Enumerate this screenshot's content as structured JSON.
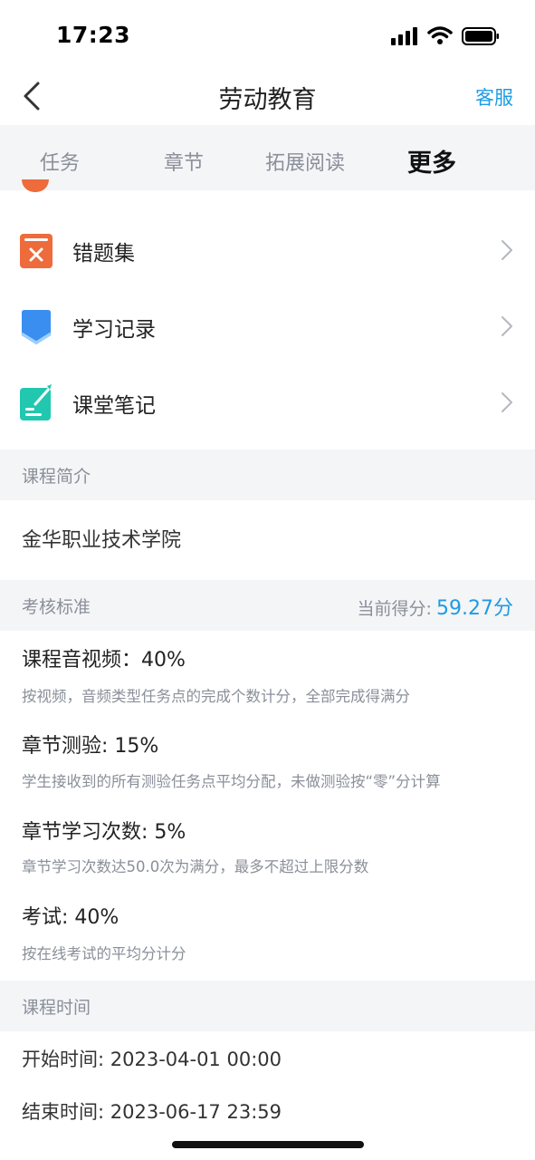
{
  "status_bar": {
    "time": "17:23"
  },
  "nav": {
    "title": "劳动教育",
    "service": "客服"
  },
  "tabs": [
    {
      "label": "任务",
      "active": false
    },
    {
      "label": "章节",
      "active": false
    },
    {
      "label": "拓展阅读",
      "active": false
    },
    {
      "label": "更多",
      "active": true
    }
  ],
  "menu_items": [
    {
      "label": "错题集",
      "icon": "wrong-questions-icon",
      "color": "#ee6b3c"
    },
    {
      "label": "学习记录",
      "icon": "study-record-icon",
      "color": "#3a8ef0"
    },
    {
      "label": "课堂笔记",
      "icon": "class-notes-icon",
      "color": "#22c7b0"
    }
  ],
  "course_intro": {
    "header": "课程简介",
    "text": "金华职业技术学院"
  },
  "assessment": {
    "header": "考核标准",
    "score_label": "当前得分:",
    "score_value": "59.27分",
    "criteria": [
      {
        "title": "课程音视频：40%",
        "desc": "按视频，音频类型任务点的完成个数计分，全部完成得满分"
      },
      {
        "title": "章节测验: 15%",
        "desc": "学生接收到的所有测验任务点平均分配，未做测验按“零”分计算"
      },
      {
        "title": "章节学习次数: 5%",
        "desc": "章节学习次数达50.0次为满分，最多不超过上限分数"
      },
      {
        "title": "考试: 40%",
        "desc": "按在线考试的平均分计分"
      }
    ]
  },
  "course_time": {
    "header": "课程时间",
    "start": "开始时间: 2023-04-01 00:00",
    "end": "结束时间: 2023-06-17 23:59"
  },
  "colors": {
    "accent": "#1e9be3",
    "section_bg": "#f4f5f7"
  }
}
